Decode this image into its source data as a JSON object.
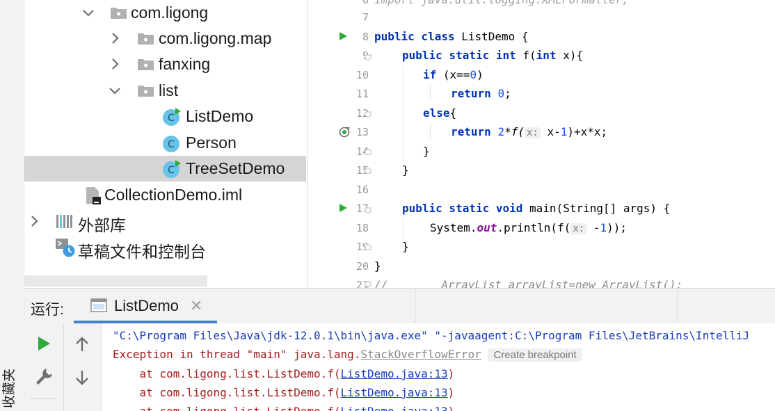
{
  "favorites": {
    "label": "收藏夹"
  },
  "project_tree": {
    "items": [
      {
        "label": "com.ligong",
        "kind": "package",
        "expanded": true
      },
      {
        "label": "com.ligong.map",
        "kind": "package",
        "expanded": false
      },
      {
        "label": "fanxing",
        "kind": "package",
        "expanded": false
      },
      {
        "label": "list",
        "kind": "package",
        "expanded": true
      },
      {
        "label": "ListDemo",
        "kind": "runnable-class"
      },
      {
        "label": "Person",
        "kind": "class"
      },
      {
        "label": "TreeSetDemo",
        "kind": "runnable-class",
        "selected": true
      },
      {
        "label": "CollectionDemo.iml",
        "kind": "iml-file"
      },
      {
        "label": "外部库",
        "kind": "library"
      },
      {
        "label": "草稿文件和控制台",
        "kind": "scratches"
      }
    ]
  },
  "editor": {
    "line_numbers": [
      "6",
      "7",
      "8",
      "9",
      "10",
      "11",
      "12",
      "13",
      "14",
      "15",
      "16",
      "17",
      "18",
      "19",
      "20",
      "21"
    ],
    "lines": {
      "l6": "import java.util.logging.XMLFormatter;",
      "l8a": "public class",
      "l8b": " ListDemo {",
      "l9a": "public static int",
      "l9b": " f(",
      "l9c": "int",
      "l9d": " x){",
      "l10a": "if",
      "l10b": " (x==",
      "l10c": "0",
      "l10d": ")",
      "l11a": "return",
      "l11b": " ",
      "l11c": "0",
      "l11d": ";",
      "l12a": "else",
      "l12b": "{",
      "l13a": "return",
      "l13b": " ",
      "l13c": "2",
      "l13d": "*f(",
      "l13e": "x:",
      "l13f": " x-",
      "l13g": "1",
      "l13h": ")+x*x;",
      "l14": "}",
      "l15": "}",
      "l17a": "public static void",
      "l17b": " main(String[] args) {",
      "l18a": "System.",
      "l18b": "out",
      "l18c": ".println(f(",
      "l18d": "x:",
      "l18e": " -",
      "l18f": "1",
      "l18g": "));",
      "l19": "}",
      "l20": "}",
      "l21": "//        ArrayList arrayList=new ArrayList();"
    }
  },
  "run_panel": {
    "label": "运行:",
    "tab_label": "ListDemo",
    "tab_close": "✕"
  },
  "console": {
    "cmd_line": "\"C:\\Program Files\\Java\\jdk-12.0.1\\bin\\java.exe\" \"-javaagent:C:\\Program Files\\JetBrains\\IntelliJ",
    "exception_prefix": "Exception in thread \"main\" java.lang.",
    "exception_name": "StackOverflowError",
    "create_breakpoint": "Create breakpoint",
    "stack_prefix": "    at com.ligong.list.ListDemo.f(",
    "stack_link": "ListDemo.java:13",
    "stack_suffix": ")"
  },
  "colors": {
    "accent": "#4083c9",
    "run_green": "#2eaa3c",
    "keyword": "#0033b3",
    "number": "#1750eb",
    "error": "#a41c1c"
  },
  "icons": [
    "play-icon",
    "wrench-icon",
    "arrow-up-icon",
    "arrow-down-icon",
    "folder-icon",
    "class-icon",
    "library-icon",
    "scratch-icon"
  ]
}
